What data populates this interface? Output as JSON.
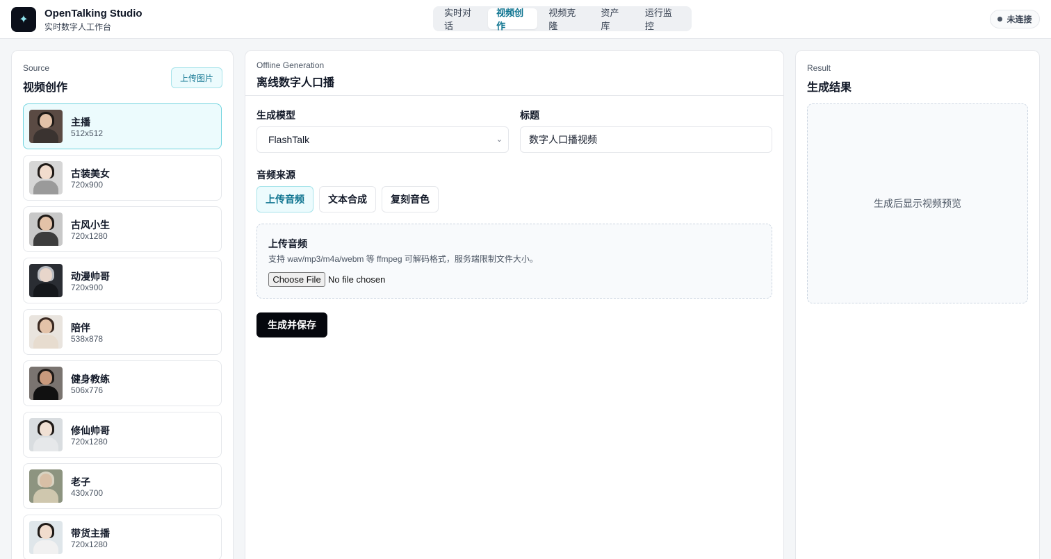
{
  "app": {
    "title": "OpenTalking Studio",
    "subtitle": "实时数字人工作台",
    "logo_icon": "sparkle-icon"
  },
  "nav": {
    "tabs": [
      {
        "label": "实时对话",
        "active": false
      },
      {
        "label": "视频创作",
        "active": true
      },
      {
        "label": "视频克隆",
        "active": false
      },
      {
        "label": "资产库",
        "active": false
      },
      {
        "label": "运行监控",
        "active": false
      }
    ]
  },
  "connection": {
    "label": "未连接",
    "dot_color": "#4b5563"
  },
  "source": {
    "eyebrow": "Source",
    "title": "视频创作",
    "upload_button": "上传图片",
    "avatars": [
      {
        "name": "主播",
        "size": "512x512",
        "selected": true
      },
      {
        "name": "古装美女",
        "size": "720x900",
        "selected": false
      },
      {
        "name": "古风小生",
        "size": "720x1280",
        "selected": false
      },
      {
        "name": "动漫帅哥",
        "size": "720x900",
        "selected": false
      },
      {
        "name": "陪伴",
        "size": "538x878",
        "selected": false
      },
      {
        "name": "健身教练",
        "size": "506x776",
        "selected": false
      },
      {
        "name": "修仙帅哥",
        "size": "720x1280",
        "selected": false
      },
      {
        "name": "老子",
        "size": "430x700",
        "selected": false
      },
      {
        "name": "带货主播",
        "size": "720x1280",
        "selected": false
      }
    ]
  },
  "generation": {
    "eyebrow": "Offline Generation",
    "title": "离线数字人口播",
    "model_label": "生成模型",
    "model_value": "FlashTalk",
    "title_label": "标题",
    "title_value": "数字人口播视频",
    "audio_source_label": "音频来源",
    "audio_options": [
      {
        "label": "上传音频",
        "active": true
      },
      {
        "label": "文本合成",
        "active": false
      },
      {
        "label": "复刻音色",
        "active": false
      }
    ],
    "upload": {
      "title": "上传音频",
      "description": "支持 wav/mp3/m4a/webm 等 ffmpeg 可解码格式，服务端限制文件大小。",
      "file_button": "Choose File",
      "file_status": "No file chosen"
    },
    "submit_button": "生成并保存"
  },
  "result": {
    "eyebrow": "Result",
    "title": "生成结果",
    "placeholder": "生成后显示视频预览"
  },
  "colors": {
    "accent": "#0e7490",
    "accent_bg": "#ecfbfd",
    "primary_button": "#05070d"
  }
}
